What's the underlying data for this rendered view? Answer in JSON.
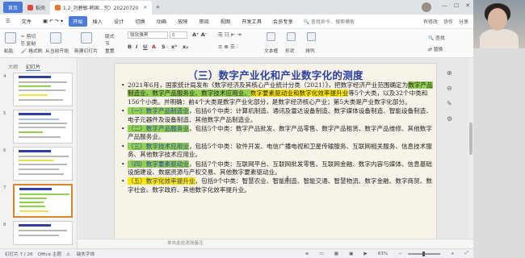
{
  "tabs": {
    "home": "首页",
    "daoke": "稻壳",
    "doc": "1.2_刘碧敏-韩国…究）20220720",
    "add": "+"
  },
  "menu": {
    "items": [
      "文件",
      "开始",
      "插入",
      "设计",
      "切换",
      "动画",
      "放映",
      "审阅",
      "视图",
      "开发工具",
      "会员专享"
    ],
    "active": "开始",
    "search": "查找命令、搜索模板",
    "right": [
      "有修改",
      "协作",
      "分享"
    ]
  },
  "ribbon": {
    "paste": "粘贴",
    "cut": "剪切",
    "copy": "复制",
    "format_painter": "格式刷",
    "from_current": "从当前开始",
    "new_slide": "新建幻灯片",
    "layout": "版式",
    "section": "节",
    "reset": "重置",
    "font_name": "微软雅黑",
    "font_size": "0",
    "text_box": "文本框",
    "shapes": "形状",
    "arrange": "排列",
    "find": "查找",
    "replace": "替换"
  },
  "left_panel": {
    "tab_outline": "大纲",
    "tab_slides": "幻灯片",
    "slide_numbers": [
      "4",
      "5",
      "6",
      "7",
      "8"
    ]
  },
  "slide": {
    "title": "（三）数字产业化和产业数字化的测度",
    "paragraphs": [
      {
        "pre": "2021年6月，国家统计局发布《数字经济及其核心产业统计分类（2021）》，把数字经济产业范围确定为",
        "g": "数字产品制造业、数字产品服务业、数字技术应用业、",
        "y": "数字要素驱动业和数字化效率提升业",
        "post": "等5个大类，以及32个中类和156个小类。并明确：前4个大类是数字产业化部分，是数字经济核心产业；第5大类是产业数字化部分。"
      },
      {
        "label": "（一）数字产品制造业",
        "text": "，包括6个中类：计算机制造、通讯及雷达设备制造、数字媒体设备制造、智能设备制造、电子元器件及设备制造、其他数字产品制造业。"
      },
      {
        "label": "（二）数字产品服务业",
        "text": "，包括5个中类：数字产品批发、数字产品零售、数字产品租赁、数字产品维修、其他数字产品服务业。"
      },
      {
        "label": "（三）数字技术应用业",
        "text": "，包括5个中类：软件开发、电信广播电视和卫星传输服务、互联网相关服务、信息技术服务、其他数字技术应用业。"
      },
      {
        "label": "（四）数字要素驱动业",
        "text": "，包括7个中类：互联网平台、互联网批发零售、互联网金融、数字内容与媒体、信息基础设施建设、数据资源与产权交易、其他数字要素驱动业。"
      },
      {
        "label": "（五）数字化效率提升业",
        "text": "，包括9个中类：智慧农业、智能制造、智能交通、智慧物流、数字金融、数字商贸、数字社会、数字政府、其他数字化效率提升业。"
      }
    ],
    "bullet": "•"
  },
  "notes": "单击此处添加备注",
  "status": {
    "slide": "幻灯片 7 / 26",
    "theme": "Office 主题",
    "font_warn": "缺失字体",
    "zoom": "63%"
  },
  "colors": {
    "accent": "#4a7ad8",
    "title": "#2a3fa0",
    "green_hl": "#92d050",
    "yellow_hl": "#ffe800",
    "blue_hl": "#9ec2f0"
  }
}
